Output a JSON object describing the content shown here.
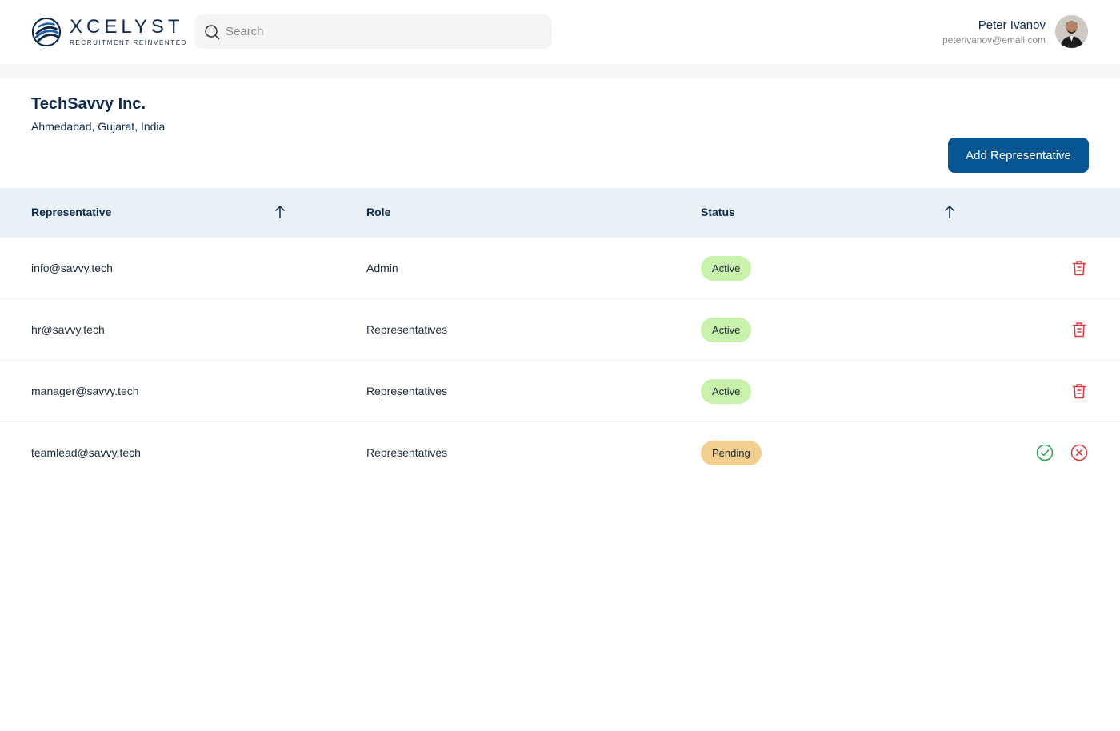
{
  "brand": {
    "name": "XCELYST",
    "tagline": "RECRUITMENT REINVENTED"
  },
  "search": {
    "placeholder": "Search",
    "value": ""
  },
  "user": {
    "name": "Peter Ivanov",
    "email": "peterivanov@email.com"
  },
  "company": {
    "name": "TechSavvy Inc.",
    "location": "Ahmedabad, Gujarat, India"
  },
  "actions": {
    "add_label": "Add Representative"
  },
  "table": {
    "columns": [
      "Representative",
      "Role",
      "Status"
    ],
    "rows": [
      {
        "email": "info@savvy.tech",
        "role": "Admin",
        "status": "Active"
      },
      {
        "email": "hr@savvy.tech",
        "role": "Representatives",
        "status": "Active"
      },
      {
        "email": "manager@savvy.tech",
        "role": "Representatives",
        "status": "Active"
      },
      {
        "email": "teamlead@savvy.tech",
        "role": "Representatives",
        "status": "Pending"
      }
    ]
  },
  "colors": {
    "brand_navy": "#0f2a4d",
    "button_blue": "#045592",
    "active_badge": "#c8f1ab",
    "pending_badge": "#f2cf8f",
    "delete_red": "#d93a3a",
    "approve_green": "#2e9e55"
  },
  "icons": {
    "search": "search-icon",
    "sort": "arrow-up-icon",
    "delete": "trash-icon",
    "approve": "check-circle-icon",
    "reject": "x-circle-icon"
  }
}
